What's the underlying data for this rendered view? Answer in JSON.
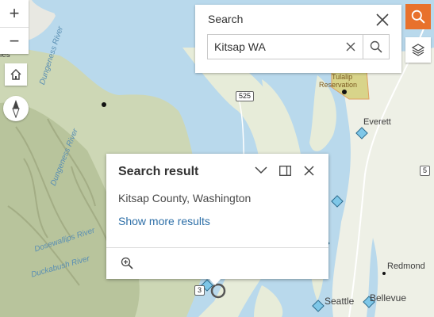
{
  "map": {
    "place_labels": [
      "les",
      "Everett",
      "Redmond",
      "Seattle",
      "Bellevue",
      "Tulalip",
      "Reservation"
    ],
    "highway_shields": [
      "525",
      "5",
      "3"
    ],
    "rivers": [
      "Dungeness River",
      "Dungeness River",
      "Dosewallips River",
      "Duckabush River"
    ]
  },
  "controls": {
    "zoom_in_icon": "plus-icon",
    "zoom_out_icon": "minus-icon",
    "home_icon": "home-icon",
    "compass_icon": "compass-icon",
    "layers_icon": "layers-icon",
    "zoom_in_glyph": "+",
    "zoom_out_glyph": "−"
  },
  "search": {
    "title": "Search",
    "value": "Kitsap WA",
    "placeholder": "Kitsap WA",
    "accent_color": "#e8712c"
  },
  "popup": {
    "title": "Search result",
    "content": "Kitsap County, Washington",
    "link": "Show more results"
  }
}
